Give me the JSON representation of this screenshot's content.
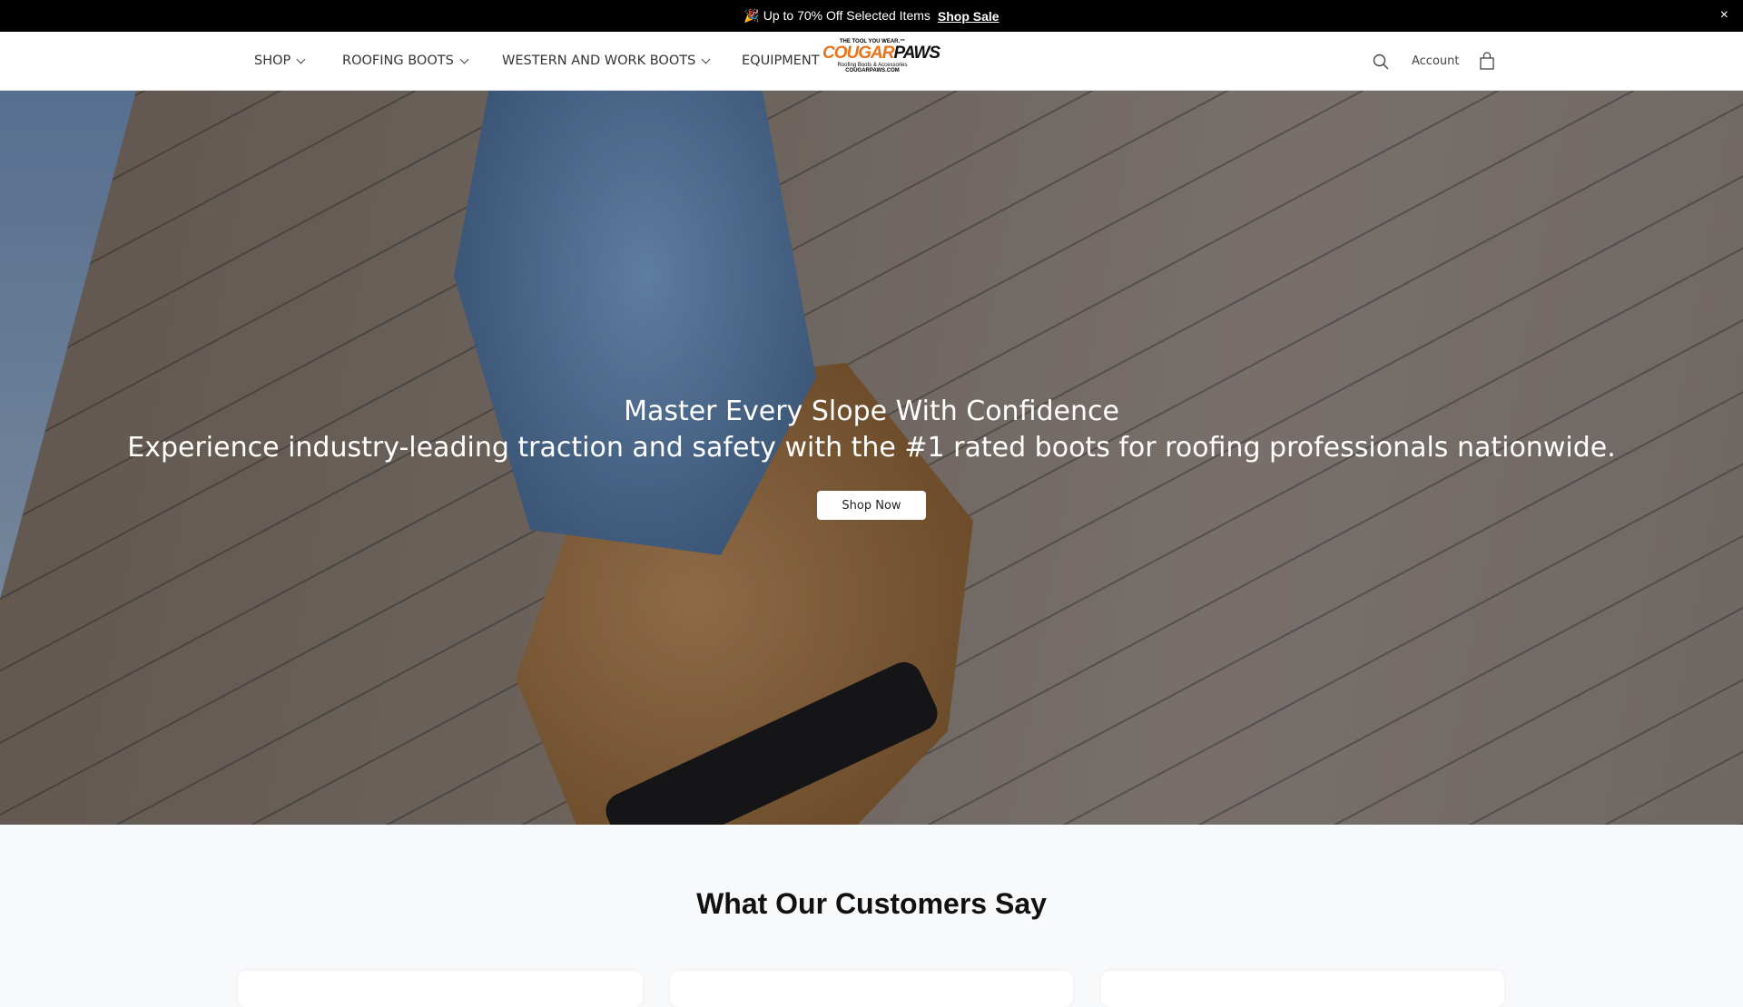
{
  "announcement": {
    "icon": "party-popper-icon",
    "text": "🎉 Up to 70% Off Selected Items",
    "link": "Shop Sale",
    "close": "×"
  },
  "nav": {
    "items": [
      {
        "label": "SHOP"
      },
      {
        "label": "ROOFING BOOTS"
      },
      {
        "label": "WESTERN AND WORK BOOTS"
      },
      {
        "label": "EQUIPMENT"
      }
    ],
    "logo": {
      "tagline": "THE TOOL YOU WEAR.™",
      "brand_a": "COUGAR",
      "brand_b": "PAWS",
      "sub": "Roofing Boots & Accessories",
      "url": "COUGARPAWS.COM"
    },
    "account": "Account"
  },
  "hero": {
    "title": "Master Every Slope With Confidence",
    "subtitle": "Experience industry-leading traction and safety with the #1 rated boots for roofing professionals nationwide.",
    "cta": "Shop Now"
  },
  "reviews": {
    "title": "What Our Customers Say"
  }
}
